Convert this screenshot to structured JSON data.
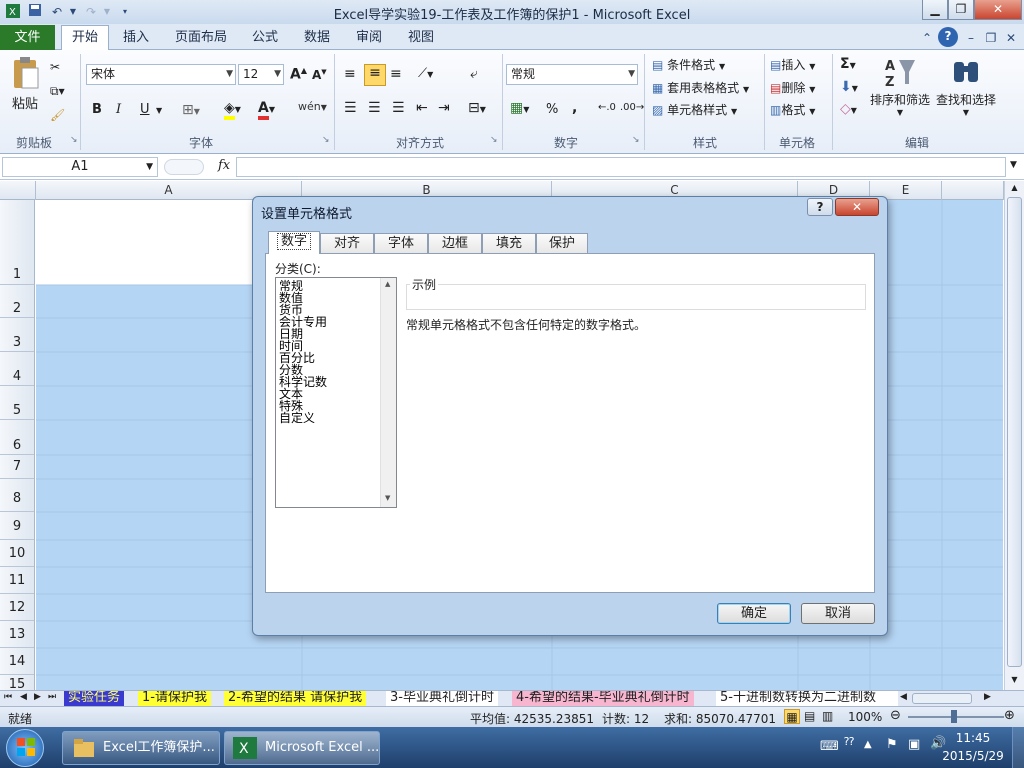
{
  "window": {
    "title": "Excel导学实验19-工作表及工作簿的保护1 - Microsoft Excel"
  },
  "ribbon": {
    "file_tab": "文件",
    "tabs": [
      "开始",
      "插入",
      "页面布局",
      "公式",
      "数据",
      "审阅",
      "视图"
    ],
    "clipboard": {
      "paste": "粘贴",
      "group": "剪贴板"
    },
    "font": {
      "name": "宋体",
      "size": "12",
      "group": "字体",
      "bold": "B",
      "italic": "I",
      "underline": "U"
    },
    "alignment": {
      "group": "对齐方式"
    },
    "number": {
      "format": "常规",
      "group": "数字",
      "percent": "%",
      "comma": ","
    },
    "styles": {
      "conditional": "条件格式",
      "table": "套用表格格式",
      "cell": "单元格样式",
      "group": "样式"
    },
    "cells": {
      "insert": "插入",
      "delete": "删除",
      "format": "格式",
      "group": "单元格"
    },
    "editing": {
      "sort": "排序和筛选",
      "find": "查找和选择",
      "group": "编辑"
    }
  },
  "formula_bar": {
    "name_box": "A1",
    "fx": "fx",
    "value": ""
  },
  "columns": [
    "A",
    "B",
    "C",
    "D",
    "E"
  ],
  "rows": [
    "1",
    "2",
    "3",
    "4",
    "5",
    "6",
    "7",
    "8",
    "9",
    "10",
    "11",
    "12",
    "13",
    "14",
    "15"
  ],
  "sheet_tabs": [
    "实验任务",
    "1-请保护我",
    "2-希望的结果 请保护我",
    "3-毕业典礼倒计时",
    "4-希望的结果-毕业典礼倒计时",
    "5-十进制数转换为二进制数"
  ],
  "status": {
    "ready": "就绪",
    "average": "平均值: 42535.23851",
    "count": "计数: 12",
    "sum": "求和: 85070.47701",
    "zoom": "100%"
  },
  "dialog": {
    "title": "设置单元格格式",
    "help": "?",
    "close": "✕",
    "tabs": [
      "数字",
      "对齐",
      "字体",
      "边框",
      "填充",
      "保护"
    ],
    "category_label": "分类(C):",
    "categories": [
      "常规",
      "数值",
      "货币",
      "会计专用",
      "日期",
      "时间",
      "百分比",
      "分数",
      "科学记数",
      "文本",
      "特殊",
      "自定义"
    ],
    "sample_label": "示例",
    "description": "常规单元格格式不包含任何特定的数字格式。",
    "ok": "确定",
    "cancel": "取消"
  },
  "taskbar": {
    "items": [
      "Excel工作簿保护...",
      "Microsoft Excel ..."
    ],
    "time": "11:45",
    "date": "2015/5/29"
  },
  "colors": {
    "selection": "#b5d5f5",
    "file_tab": "#2a7a2a",
    "taskbar": "#2a5182"
  }
}
